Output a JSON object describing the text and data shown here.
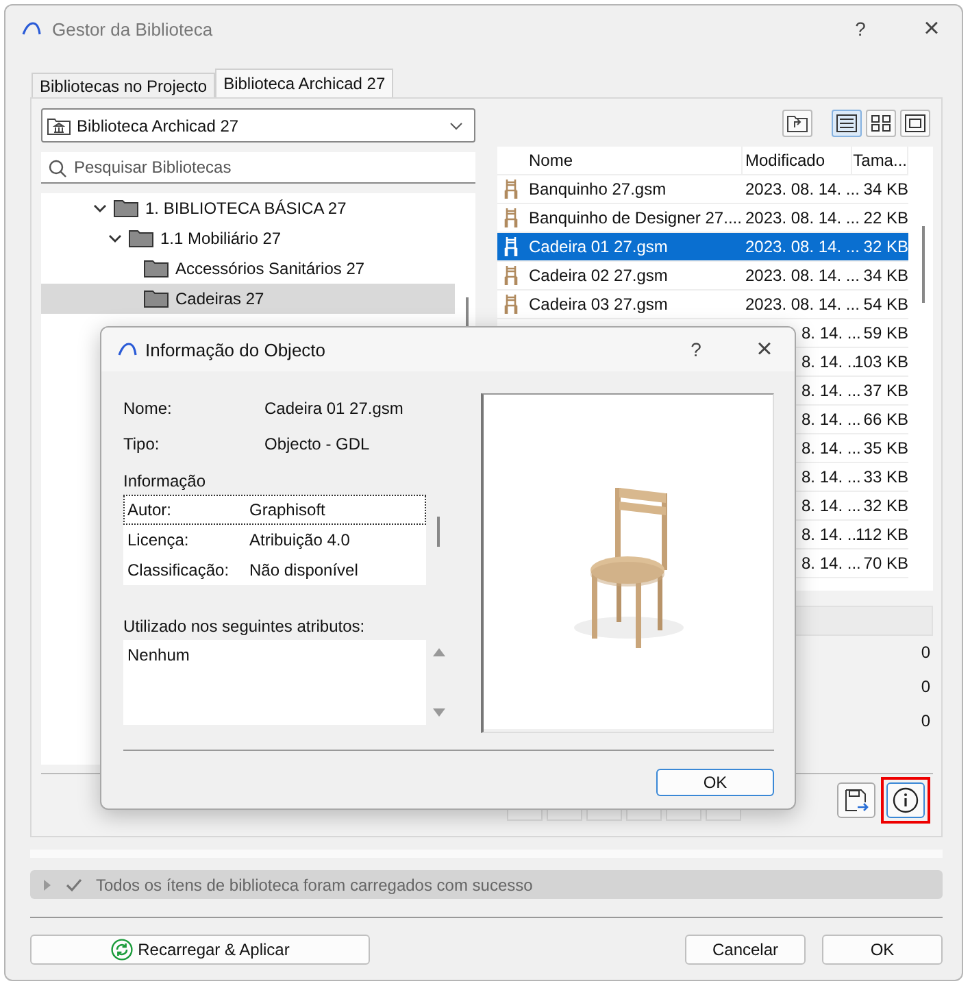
{
  "window": {
    "title": "Gestor da Biblioteca",
    "help": "?",
    "close": "×"
  },
  "tabs": [
    {
      "label": "Bibliotecas no Projecto",
      "selected": false
    },
    {
      "label": "Biblioteca Archicad 27",
      "selected": true
    }
  ],
  "library_dropdown": {
    "value": "Biblioteca Archicad 27"
  },
  "search": {
    "placeholder": "Pesquisar Bibliotecas"
  },
  "tree": [
    {
      "label": "1. BIBLIOTECA BÁSICA 27",
      "expanded": true,
      "selected": false,
      "children": [
        {
          "label": "1.1 Mobiliário 27",
          "expanded": true,
          "selected": false,
          "children": [
            {
              "label": "Accessórios Sanitários 27",
              "selected": false
            },
            {
              "label": "Cadeiras 27",
              "selected": true
            }
          ]
        }
      ]
    }
  ],
  "view_modes": [
    {
      "kind": "list",
      "selected": true
    },
    {
      "kind": "grid",
      "selected": false
    },
    {
      "kind": "preview",
      "selected": false
    }
  ],
  "file_list": {
    "columns": [
      "Nome",
      "Modificado",
      "Tama..."
    ],
    "rows": [
      {
        "name": "Banquinho 27.gsm",
        "modified": "2023. 08. 14. ...",
        "size": "34 KB",
        "selected": false
      },
      {
        "name": "Banquinho de Designer 27....",
        "modified": "2023. 08. 14. ...",
        "size": "22 KB",
        "selected": false
      },
      {
        "name": "Cadeira 01 27.gsm",
        "modified": "2023. 08. 14. ...",
        "size": "32 KB",
        "selected": true
      },
      {
        "name": "Cadeira 02 27.gsm",
        "modified": "2023. 08. 14. ...",
        "size": "34 KB",
        "selected": false
      },
      {
        "name": "Cadeira 03 27.gsm",
        "modified": "2023. 08. 14. ...",
        "size": "54 KB",
        "selected": false
      },
      {
        "modified": "8. 14. ...",
        "size": "59 KB",
        "selected": false
      },
      {
        "modified": "8. 14. ...",
        "size": "103 KB",
        "selected": false
      },
      {
        "modified": "8. 14. ...",
        "size": "37 KB",
        "selected": false
      },
      {
        "modified": "8. 14. ...",
        "size": "66 KB",
        "selected": false
      },
      {
        "modified": "8. 14. ...",
        "size": "35 KB",
        "selected": false
      },
      {
        "modified": "8. 14. ...",
        "size": "33 KB",
        "selected": false
      },
      {
        "modified": "8. 14. ...",
        "size": "32 KB",
        "selected": false
      },
      {
        "modified": "8. 14. ...",
        "size": "112 KB",
        "selected": false
      },
      {
        "modified": "8. 14. ...",
        "size": "70 KB",
        "selected": false
      }
    ]
  },
  "details": {
    "values": [
      "0",
      "0",
      "0"
    ]
  },
  "info_button": {
    "highlighted": true
  },
  "status": {
    "text": "Todos os ítens de biblioteca foram carregados com sucesso",
    "expanded": false
  },
  "buttons": {
    "reload": "Recarregar & Aplicar",
    "cancel": "Cancelar",
    "ok": "OK"
  },
  "object_info": {
    "title": "Informação do Objecto",
    "help": "?",
    "close": "×",
    "fields": [
      {
        "label": "Nome:",
        "value": "Cadeira 01 27.gsm"
      },
      {
        "label": "Tipo:",
        "value": "Objecto - GDL"
      }
    ],
    "info_heading": "Informação",
    "info": [
      {
        "key": "Autor:",
        "value": "Graphisoft",
        "selected": true
      },
      {
        "key": "Licença:",
        "value": "Atribuição 4.0",
        "selected": false
      },
      {
        "key": "Classificação:",
        "value": "Não disponível",
        "selected": false
      }
    ],
    "used_heading": "Utilizado nos seguintes atributos:",
    "used": [
      "Nenhum"
    ],
    "ok": "OK",
    "preview": {
      "kind": "picture"
    }
  }
}
